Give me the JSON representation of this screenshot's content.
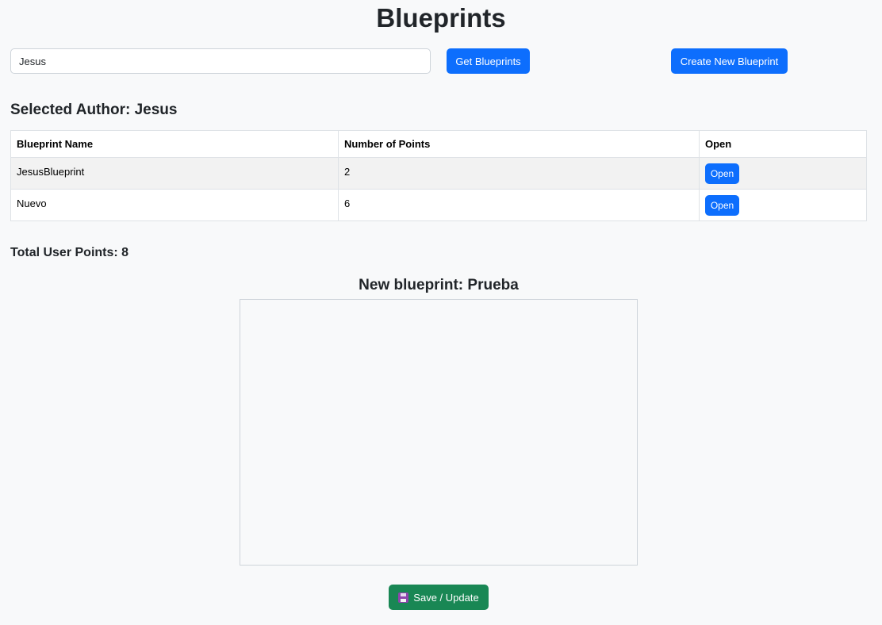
{
  "page": {
    "title": "Blueprints"
  },
  "search": {
    "author_value": "Jesus",
    "get_button_label": "Get Blueprints",
    "create_button_label": "Create New Blueprint"
  },
  "selected_author": {
    "label": "Selected Author: Jesus"
  },
  "table": {
    "headers": [
      "Blueprint Name",
      "Number of Points",
      "Open"
    ],
    "rows": [
      {
        "name": "JesusBlueprint",
        "points": "2",
        "open_label": "Open"
      },
      {
        "name": "Nuevo",
        "points": "6",
        "open_label": "Open"
      }
    ]
  },
  "totals": {
    "label": "Total User Points: 8"
  },
  "editor": {
    "title": "New blueprint: Prueba",
    "save_label": "Save / Update",
    "save_icon": "floppy-disk-icon"
  },
  "colors": {
    "primary": "#0d6efd",
    "success": "#198754",
    "background": "#f8f9fa"
  }
}
